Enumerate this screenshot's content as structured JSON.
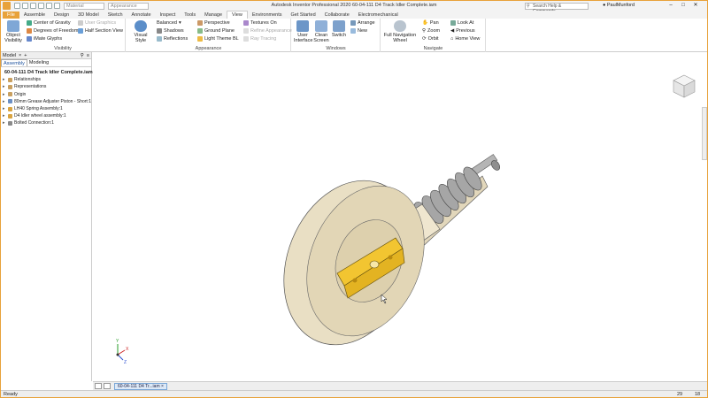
{
  "titlebar": {
    "quick_access_dropdown1": "Material",
    "quick_access_dropdown2": "Appearance",
    "document_title": "Autodesk Inventor Professional 2020   60-04-111 D4 Track Idler Complete.iam",
    "search_placeholder": "Search Help & Commands...",
    "user": "PaulMunford"
  },
  "tabs": [
    "File",
    "Assemble",
    "Design",
    "3D Model",
    "Sketch",
    "Annotate",
    "Inspect",
    "Tools",
    "Manage",
    "View",
    "Environments",
    "Get Started",
    "Collaborate",
    "Electromechanical"
  ],
  "ribbon": {
    "visibility": {
      "label": "Visibility",
      "object_visibility": "Object Visibility",
      "center_of_gravity": "Center of Gravity",
      "degrees_of_freedom": "Degrees of Freedom",
      "imate_glyphs": "iMate Glyphs",
      "user_graphics": "User Graphics",
      "half_section_view": "Half Section View"
    },
    "appearance": {
      "label": "Appearance",
      "visual_style": "Visual Style",
      "balanced": "Balanced",
      "shadows": "Shadows",
      "reflections": "Reflections",
      "perspective": "Perspective",
      "ground_plane": "Ground Plane",
      "light_theme": "Light Theme BL",
      "textures_on": "Textures On",
      "refine_appearance": "Refine Appearance",
      "ray_tracing": "Ray Tracing"
    },
    "windows": {
      "label": "Windows",
      "user_interface": "User Interface",
      "clean_screen": "Clean Screen",
      "switch": "Switch",
      "arrange": "Arrange",
      "new": "New"
    },
    "navigate": {
      "label": "Navigate",
      "full_navigation_wheel": "Full Navigation Wheel",
      "pan": "Pan",
      "zoom": "Zoom",
      "orbit": "Orbit",
      "look_at": "Look At",
      "previous": "Previous",
      "home_view": "Home View"
    }
  },
  "browser": {
    "title": "Model",
    "tabs": [
      "Assembly",
      "Modeling"
    ],
    "root": "60-04-111 D4 Track Idler Complete.iam",
    "nodes": [
      "Relationships",
      "Representations",
      "Origin",
      "80mm Grease Adjuster Piston - Short:1",
      "LH40 Spring Assembly:1",
      "D4 Idler wheel assembly:1",
      "Bolted Connection:1"
    ]
  },
  "document_tab": "60-04-111 D4 Tr...iam",
  "status": {
    "text": "Ready",
    "count1": "29",
    "count2": "18"
  },
  "triad": {
    "x": "X",
    "y": "Y",
    "z": "Z"
  },
  "colors": {
    "accent": "#e8a23a",
    "part_tan": "#e6dcc0",
    "part_yellow": "#f2c531",
    "spring_grey": "#9e9e9e"
  }
}
